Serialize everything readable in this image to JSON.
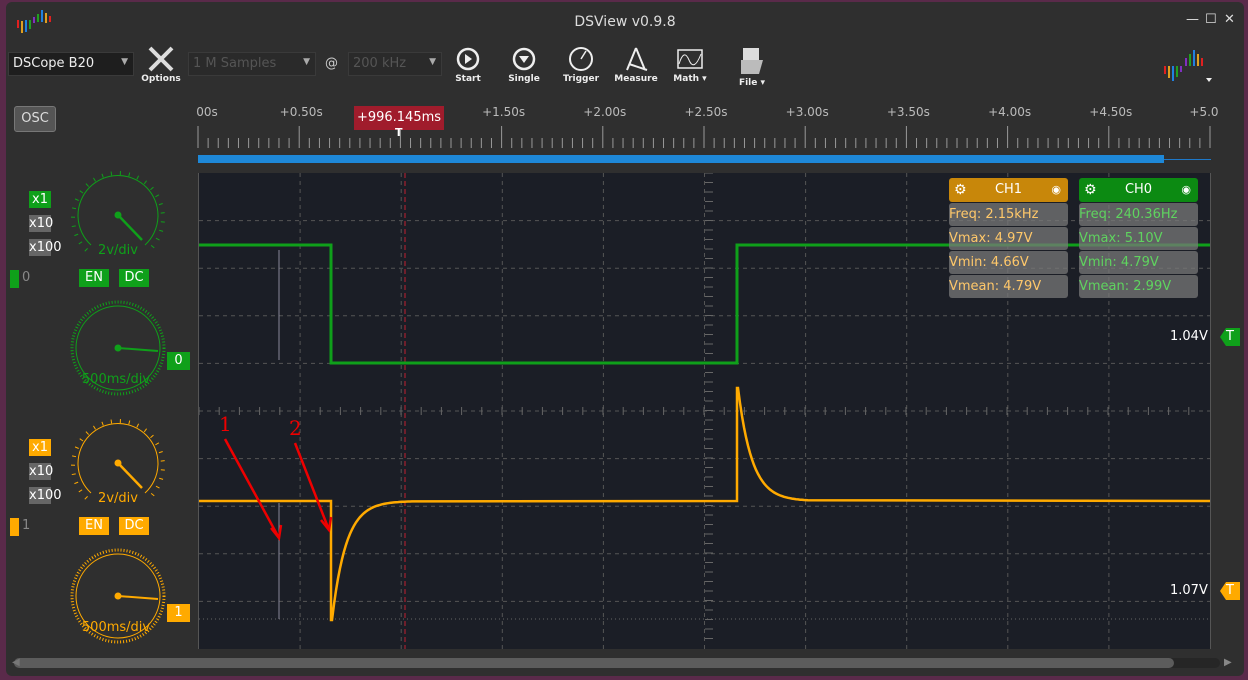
{
  "window": {
    "title": "DSView v0.9.8",
    "controls": [
      "—",
      "☐",
      "✕"
    ]
  },
  "toolbar": {
    "device": "DSCope B20",
    "options": "Options",
    "samples": "1 M Samples",
    "at": "@",
    "rate": "200 kHz",
    "start": "Start",
    "single": "Single",
    "trigger": "Trigger",
    "measure": "Measure",
    "math": "Math",
    "file": "File"
  },
  "mode": "OSC",
  "ruler": {
    "labels": [
      "00s",
      "+0.50s",
      "+1.00s",
      "+1.50s",
      "+2.00s",
      "+2.50s",
      "+3.00s",
      "+3.50s",
      "+4.00s",
      "+4.50s",
      "+5.0"
    ],
    "cursor": "+996.145ms",
    "cursor_mark": "T",
    "progress_percent": 100
  },
  "channels": [
    {
      "id": "0",
      "color": "#0fa01a",
      "probes": [
        "x1",
        "x10",
        "x100"
      ],
      "probe_selected": "x1",
      "vdiv": "2v/div",
      "en": "EN",
      "dc": "DC",
      "hdiv": "500ms/div",
      "marker": "0",
      "trigger_level": "1.04V",
      "trigger_mark": "T"
    },
    {
      "id": "1",
      "color": "#ffaa00",
      "probes": [
        "x1",
        "x10",
        "x100"
      ],
      "probe_selected": "x1",
      "vdiv": "2v/div",
      "en": "EN",
      "dc": "DC",
      "hdiv": "500ms/div",
      "marker": "1",
      "trigger_level": "1.07V",
      "trigger_mark": "T"
    }
  ],
  "measure": [
    {
      "name": "CH1",
      "head_color": "#c8870a",
      "text_color": "#ffc86a",
      "rows": [
        "Freq: 2.15kHz",
        "Vmax: 4.97V",
        "Vmin: 4.66V",
        "Vmean: 4.79V"
      ]
    },
    {
      "name": "CH0",
      "head_color": "#0c8a12",
      "text_color": "#5fd45f",
      "rows": [
        "Freq: 240.36Hz",
        "Vmax: 5.10V",
        "Vmin: 4.79V",
        "Vmean: 2.99V"
      ]
    }
  ],
  "annotations": [
    "1",
    "2"
  ]
}
